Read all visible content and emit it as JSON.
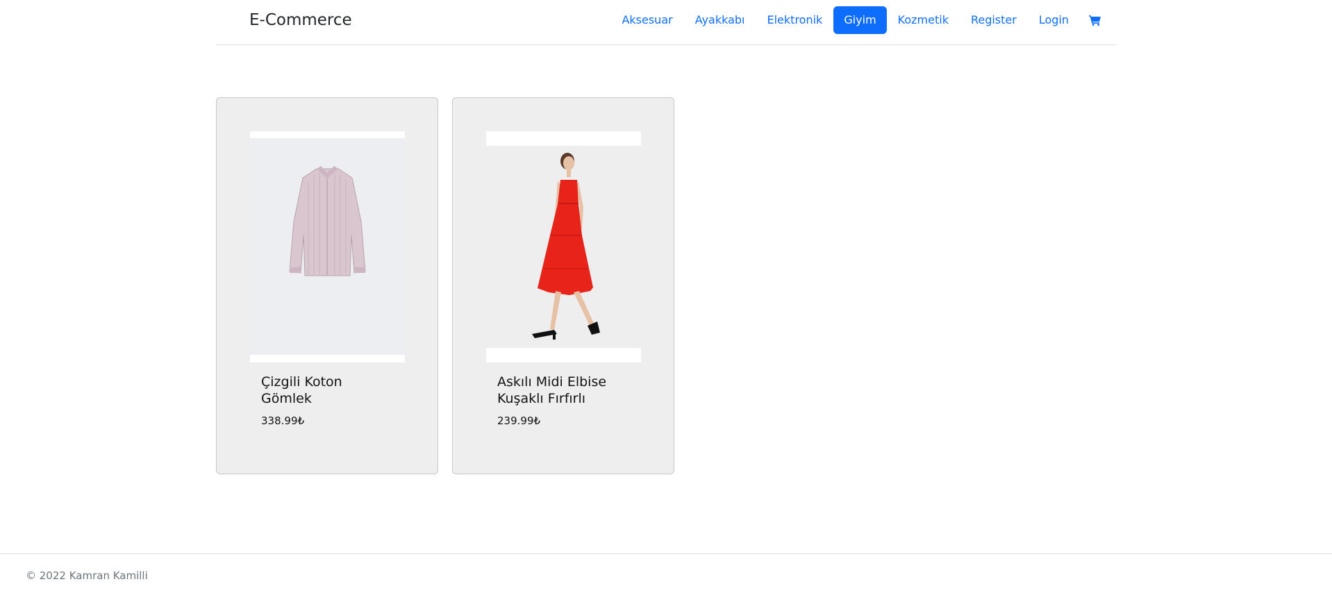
{
  "header": {
    "brand": "E-Commerce",
    "nav": [
      {
        "label": "Aksesuar",
        "active": false
      },
      {
        "label": "Ayakkabı",
        "active": false
      },
      {
        "label": "Elektronik",
        "active": false
      },
      {
        "label": "Giyim",
        "active": true
      },
      {
        "label": "Kozmetik",
        "active": false
      },
      {
        "label": "Register",
        "active": false
      },
      {
        "label": "Login",
        "active": false
      }
    ],
    "cart_icon": "cart-icon"
  },
  "products": [
    {
      "title": "Çizgili Koton Gömlek",
      "price": "338.99₺",
      "image": "striped-shirt-image"
    },
    {
      "title": "Askılı Midi Elbise Kuşaklı Fırfırlı",
      "price": "239.99₺",
      "image": "red-midi-dress-image"
    }
  ],
  "footer": {
    "text": "© 2022 Kamran Kamilli"
  },
  "colors": {
    "accent": "#0d6efd",
    "card_background": "#eeeeee",
    "footer_text": "#6c757d"
  }
}
